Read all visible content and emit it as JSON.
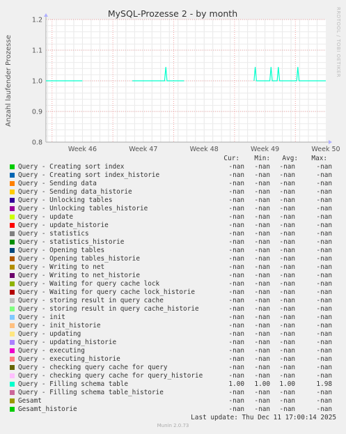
{
  "title": "MySQL-Prozesse 2 - by month",
  "side_label": "RRDTOOL / TOBI OETIKER",
  "footer": "Munin 2.0.73",
  "last_update": "Last update: Thu Dec 11 17:00:14 2025",
  "legend_headers": {
    "cur": "Cur:",
    "min": "Min:",
    "avg": "Avg:",
    "max": "Max:"
  },
  "chart_data": {
    "type": "line",
    "ylabel": "Anzahl laufender Prozesse",
    "ylim": [
      0.8,
      1.2
    ],
    "yticks": [
      "0.8",
      "0.9",
      "1.0",
      "1.1",
      "1.2"
    ],
    "xticks": [
      "Week 46",
      "Week 47",
      "Week 48",
      "Week 49",
      "Week 50"
    ],
    "xlim_weeks": [
      45.4,
      50.0
    ],
    "grid": true,
    "series": [
      {
        "name": "Query - Filling schema table",
        "color": "#00ffcc",
        "segments": [
          [
            [
              45.4,
              1.0
            ],
            [
              46.0,
              1.0
            ]
          ],
          [
            [
              46.82,
              1.0
            ],
            [
              47.35,
              1.0
            ],
            [
              47.37,
              1.045
            ],
            [
              47.39,
              1.0
            ],
            [
              47.67,
              1.0
            ]
          ],
          [
            [
              48.82,
              1.0
            ],
            [
              48.84,
              1.045
            ],
            [
              48.86,
              1.0
            ],
            [
              49.08,
              1.0
            ],
            [
              49.1,
              1.045
            ],
            [
              49.12,
              1.0
            ],
            [
              49.2,
              1.0
            ],
            [
              49.22,
              1.045
            ],
            [
              49.24,
              1.0
            ],
            [
              49.52,
              1.0
            ],
            [
              49.54,
              1.045
            ],
            [
              49.56,
              1.0
            ],
            [
              50.0,
              1.0
            ]
          ]
        ]
      }
    ]
  },
  "legend": [
    {
      "name": "Query - Creating sort index",
      "color": "#00cc00",
      "cur": "-nan",
      "min": "-nan",
      "avg": "-nan",
      "max": "-nan"
    },
    {
      "name": "Query - Creating sort index_historie",
      "color": "#0066b3",
      "cur": "-nan",
      "min": "-nan",
      "avg": "-nan",
      "max": "-nan"
    },
    {
      "name": "Query - Sending data",
      "color": "#ff8000",
      "cur": "-nan",
      "min": "-nan",
      "avg": "-nan",
      "max": "-nan"
    },
    {
      "name": "Query - Sending data_historie",
      "color": "#ffcc00",
      "cur": "-nan",
      "min": "-nan",
      "avg": "-nan",
      "max": "-nan"
    },
    {
      "name": "Query - Unlocking tables",
      "color": "#330099",
      "cur": "-nan",
      "min": "-nan",
      "avg": "-nan",
      "max": "-nan"
    },
    {
      "name": "Query - Unlocking tables_historie",
      "color": "#990099",
      "cur": "-nan",
      "min": "-nan",
      "avg": "-nan",
      "max": "-nan"
    },
    {
      "name": "Query - update",
      "color": "#ccff00",
      "cur": "-nan",
      "min": "-nan",
      "avg": "-nan",
      "max": "-nan"
    },
    {
      "name": "Query - update_historie",
      "color": "#ff0000",
      "cur": "-nan",
      "min": "-nan",
      "avg": "-nan",
      "max": "-nan"
    },
    {
      "name": "Query - statistics",
      "color": "#808080",
      "cur": "-nan",
      "min": "-nan",
      "avg": "-nan",
      "max": "-nan"
    },
    {
      "name": "Query - statistics_historie",
      "color": "#008f00",
      "cur": "-nan",
      "min": "-nan",
      "avg": "-nan",
      "max": "-nan"
    },
    {
      "name": "Query - Opening tables",
      "color": "#00487d",
      "cur": "-nan",
      "min": "-nan",
      "avg": "-nan",
      "max": "-nan"
    },
    {
      "name": "Query - Opening tables_historie",
      "color": "#b35a00",
      "cur": "-nan",
      "min": "-nan",
      "avg": "-nan",
      "max": "-nan"
    },
    {
      "name": "Query - Writing to net",
      "color": "#b38f00",
      "cur": "-nan",
      "min": "-nan",
      "avg": "-nan",
      "max": "-nan"
    },
    {
      "name": "Query - Writing to net_historie",
      "color": "#6b006b",
      "cur": "-nan",
      "min": "-nan",
      "avg": "-nan",
      "max": "-nan"
    },
    {
      "name": "Query - Waiting for query cache lock",
      "color": "#8fb300",
      "cur": "-nan",
      "min": "-nan",
      "avg": "-nan",
      "max": "-nan"
    },
    {
      "name": "Query - Waiting for query cache lock_historie",
      "color": "#b30000",
      "cur": "-nan",
      "min": "-nan",
      "avg": "-nan",
      "max": "-nan"
    },
    {
      "name": "Query - storing result in query cache",
      "color": "#bebebe",
      "cur": "-nan",
      "min": "-nan",
      "avg": "-nan",
      "max": "-nan"
    },
    {
      "name": "Query - storing result in query cache_historie",
      "color": "#80ff80",
      "cur": "-nan",
      "min": "-nan",
      "avg": "-nan",
      "max": "-nan"
    },
    {
      "name": "Query - init",
      "color": "#80c9ff",
      "cur": "-nan",
      "min": "-nan",
      "avg": "-nan",
      "max": "-nan"
    },
    {
      "name": "Query - init_historie",
      "color": "#ffc080",
      "cur": "-nan",
      "min": "-nan",
      "avg": "-nan",
      "max": "-nan"
    },
    {
      "name": "Query - updating",
      "color": "#ffe680",
      "cur": "-nan",
      "min": "-nan",
      "avg": "-nan",
      "max": "-nan"
    },
    {
      "name": "Query - updating_historie",
      "color": "#aa80ff",
      "cur": "-nan",
      "min": "-nan",
      "avg": "-nan",
      "max": "-nan"
    },
    {
      "name": "Query - executing",
      "color": "#ee00cc",
      "cur": "-nan",
      "min": "-nan",
      "avg": "-nan",
      "max": "-nan"
    },
    {
      "name": "Query - executing_historie",
      "color": "#ff8080",
      "cur": "-nan",
      "min": "-nan",
      "avg": "-nan",
      "max": "-nan"
    },
    {
      "name": "Query - checking query cache for query",
      "color": "#666600",
      "cur": "-nan",
      "min": "-nan",
      "avg": "-nan",
      "max": "-nan"
    },
    {
      "name": "Query - checking query cache for query_historie",
      "color": "#ffbfff",
      "cur": "-nan",
      "min": "-nan",
      "avg": "-nan",
      "max": "-nan"
    },
    {
      "name": "Query - Filling schema table",
      "color": "#00ffcc",
      "cur": "1.00",
      "min": "1.00",
      "avg": "1.00",
      "max": "1.98"
    },
    {
      "name": "Query - Filling schema table_historie",
      "color": "#cc6699",
      "cur": "-nan",
      "min": "-nan",
      "avg": "-nan",
      "max": "-nan"
    },
    {
      "name": "Gesamt",
      "color": "#999900",
      "cur": "-nan",
      "min": "-nan",
      "avg": "-nan",
      "max": "-nan"
    },
    {
      "name": "Gesamt_historie",
      "color": "#00cc00",
      "cur": "-nan",
      "min": "-nan",
      "avg": "-nan",
      "max": "-nan"
    }
  ]
}
